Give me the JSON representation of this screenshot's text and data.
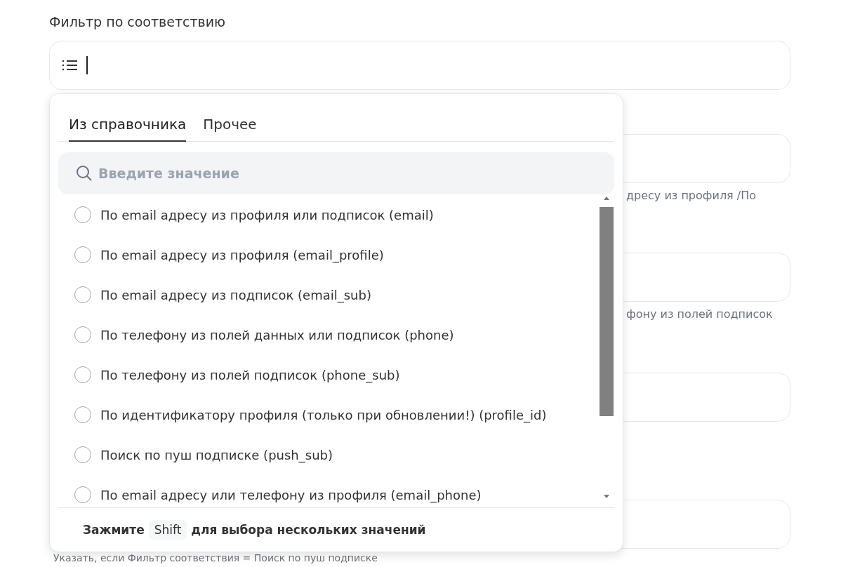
{
  "filter_label": "Фильтр по соответствию",
  "background_fields": [
    {
      "kind": "hinted",
      "hint": "дресу из профиля /По"
    },
    {
      "kind": "hinted",
      "hint": "фону из полей подписок"
    },
    {
      "kind": "plain"
    },
    {
      "kind": "plain"
    }
  ],
  "bottom_hint": "Указать, если Фильтр соответствия = Поиск по пуш подписке",
  "dropdown": {
    "tabs": [
      {
        "label": "Из справочника",
        "selected": true
      },
      {
        "label": "Прочее",
        "selected": false
      }
    ],
    "search": {
      "placeholder": "Введите значение"
    },
    "options": [
      {
        "label": "По email адресу из профиля или подписок (email)",
        "selected": false
      },
      {
        "label": "По email адресу из профиля (email_profile)",
        "selected": false
      },
      {
        "label": "По email адресу из подписок (email_sub)",
        "selected": false
      },
      {
        "label": "По телефону из полей данных или подписок (phone)",
        "selected": false
      },
      {
        "label": "По телефону из полей подписок (phone_sub)",
        "selected": false
      },
      {
        "label": "По идентификатору профиля (только при обновлении!) (profile_id)",
        "selected": false
      },
      {
        "label": "Поиск по пуш подписке (push_sub)",
        "selected": false
      },
      {
        "label": "По email адресу или телефону из профиля (email_phone)",
        "selected": false
      }
    ],
    "footer": {
      "before": "Зажмите",
      "key": "Shift",
      "after": "для выбора нескольких значений"
    }
  }
}
